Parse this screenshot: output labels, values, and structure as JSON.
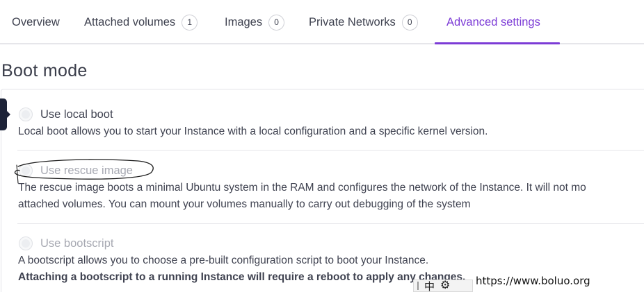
{
  "tabs": [
    {
      "label": "Overview",
      "count": null,
      "active": false
    },
    {
      "label": "Attached volumes",
      "count": "1",
      "active": false
    },
    {
      "label": "Images",
      "count": "0",
      "active": false
    },
    {
      "label": "Private Networks",
      "count": "0",
      "active": false
    },
    {
      "label": "Advanced settings",
      "count": null,
      "active": true
    }
  ],
  "section": {
    "title": "Boot mode"
  },
  "options": [
    {
      "label": "Use local boot",
      "description": "Local boot allows you to start your Instance with a local configuration and a specific kernel version."
    },
    {
      "label": "Use rescue image",
      "description_line1": "The rescue image boots a minimal Ubuntu system in the RAM and configures the network of the Instance. It will not mo",
      "description_line2": "attached volumes. You can mount your volumes manually to carry out debugging of the system"
    },
    {
      "label": "Use bootscript",
      "description": "A bootscript allows you to choose a pre-built configuration script to boot your Instance.",
      "warning": "Attaching a bootscript to a running Instance will require a reboot to apply any changes."
    }
  ],
  "ime": {
    "mode": "中",
    "icons": [
      "grip-icon",
      "gear-icon"
    ]
  },
  "watermark": "https://www.boluo.org",
  "colors": {
    "accent": "#7c3bd6",
    "text": "#3f4250",
    "disabled": "#a7a9b2",
    "marker": "#1d2338"
  }
}
